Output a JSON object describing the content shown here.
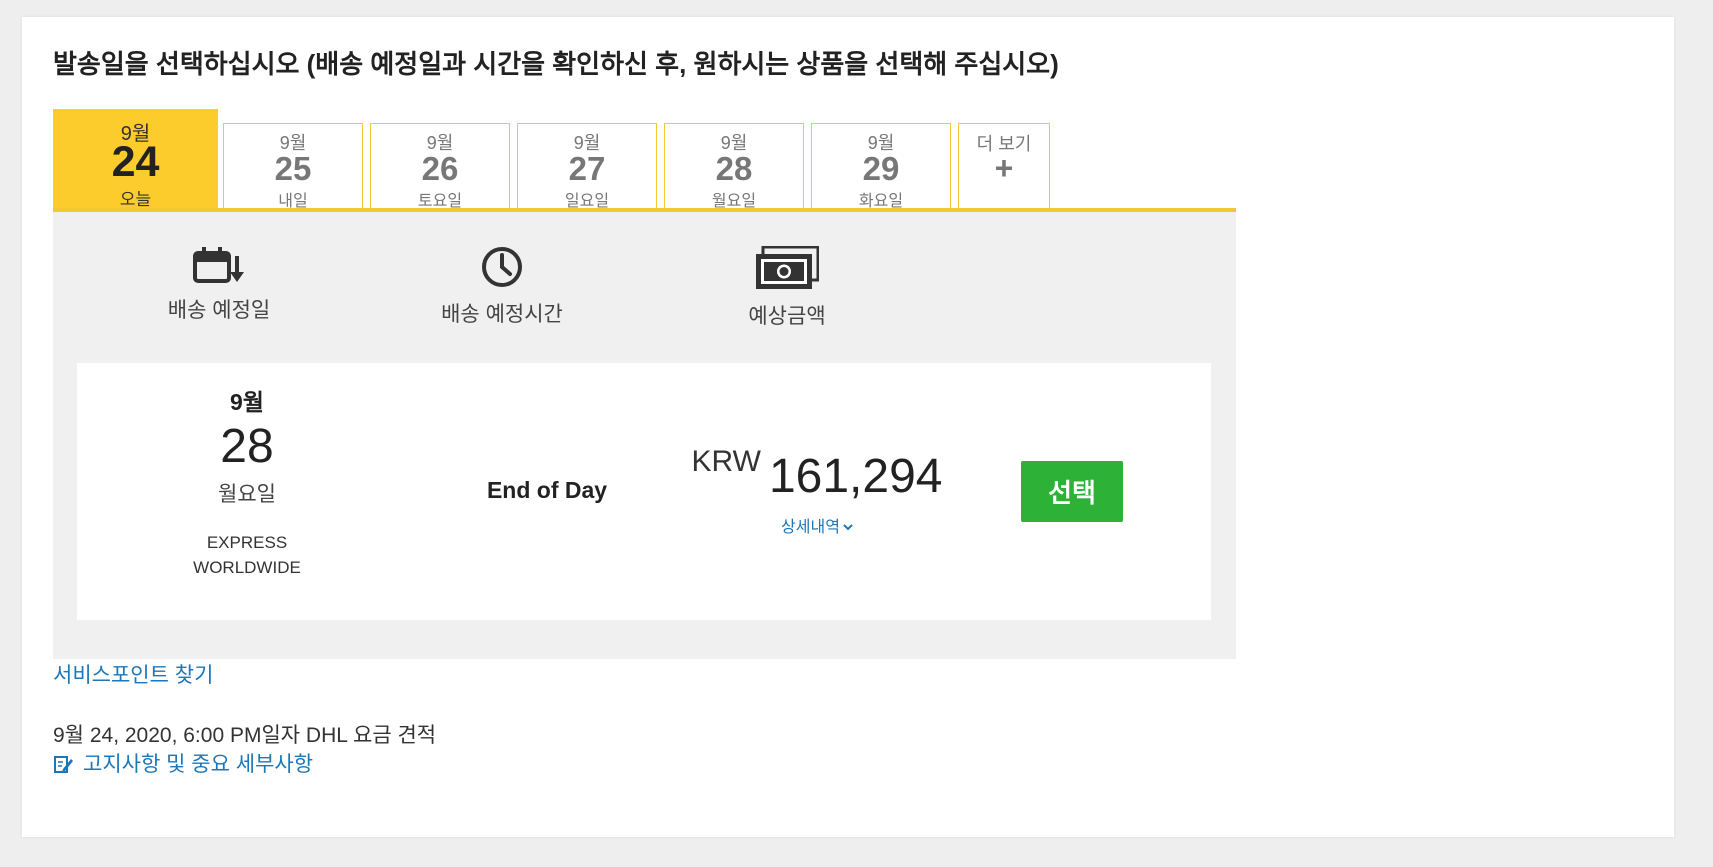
{
  "title": "발송일을 선택하십시오 (배송 예정일과 시간을 확인하신 후, 원하시는 상품을 선택해 주십시오)",
  "tabs": [
    {
      "month": "9월",
      "day": "24",
      "label": "오늘"
    },
    {
      "month": "9월",
      "day": "25",
      "label": "내일"
    },
    {
      "month": "9월",
      "day": "26",
      "label": "토요일"
    },
    {
      "month": "9월",
      "day": "27",
      "label": "일요일"
    },
    {
      "month": "9월",
      "day": "28",
      "label": "월요일"
    },
    {
      "month": "9월",
      "day": "29",
      "label": "화요일"
    }
  ],
  "more_tab": {
    "label": "더 보기",
    "plus": "+"
  },
  "columns": {
    "delivery_date": "배송 예정일",
    "delivery_time": "배송 예정시간",
    "estimated_price": "예상금액"
  },
  "result": {
    "month": "9월",
    "day": "28",
    "weekday": "월요일",
    "service_line1": "EXPRESS",
    "service_line2": "WORLDWIDE",
    "time": "End of Day",
    "currency": "KRW",
    "amount": "161,294",
    "details_label": "상세내역",
    "select_label": "선택"
  },
  "service_point_link": "서비스포인트 찾기",
  "quote_info": "9월 24, 2020, 6:00 PM일자 DHL 요금 견적",
  "notice_link": "고지사항 및 중요 세부사항",
  "colors": {
    "accent_yellow": "#fccc2c",
    "link_blue": "#1c77b9",
    "select_green": "#2db136"
  },
  "icons": {
    "delivery_date": "calendar-arrow-icon",
    "delivery_time": "clock-icon",
    "price": "money-icon",
    "details": "chevron-down-icon",
    "notice": "edit-icon"
  }
}
